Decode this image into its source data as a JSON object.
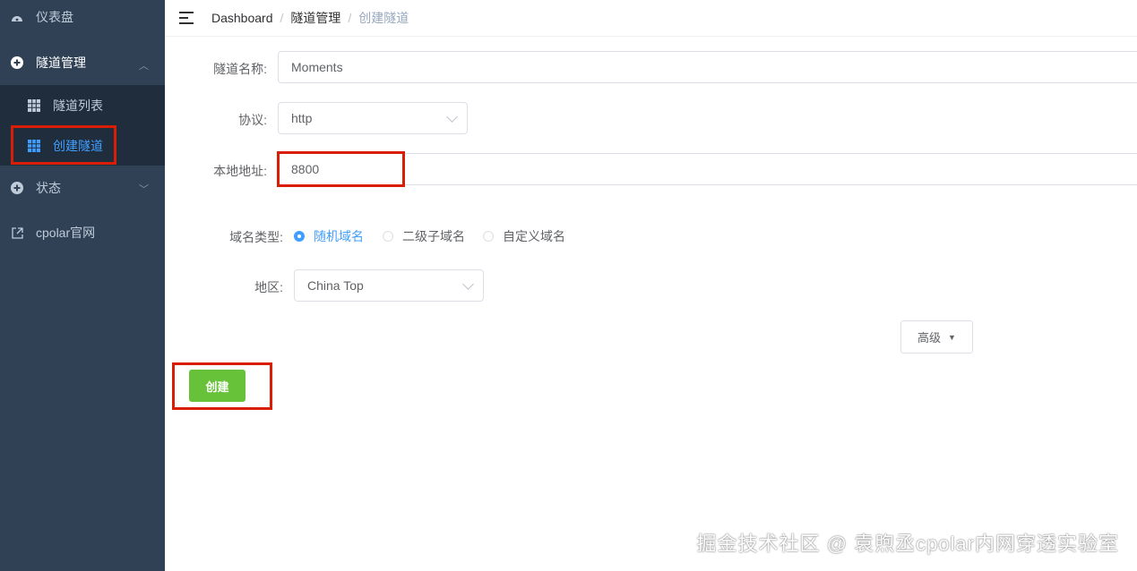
{
  "sidebar": {
    "items": [
      {
        "label": "仪表盘"
      },
      {
        "label": "隧道管理"
      },
      {
        "label": "状态"
      },
      {
        "label": "cpolar官网"
      }
    ],
    "sub_items": [
      {
        "label": "隧道列表"
      },
      {
        "label": "创建隧道"
      }
    ]
  },
  "breadcrumb": {
    "home": "Dashboard",
    "section": "隧道管理",
    "current": "创建隧道",
    "sep": "/"
  },
  "form": {
    "name_label": "隧道名称:",
    "name_value": "Moments",
    "protocol_label": "协议:",
    "protocol_value": "http",
    "local_label": "本地地址:",
    "local_value": "8800",
    "domain_type_label": "域名类型:",
    "domain_options": [
      "随机域名",
      "二级子域名",
      "自定义域名"
    ],
    "region_label": "地区:",
    "region_value": "China Top",
    "advanced_label": "高级",
    "create_label": "创建"
  },
  "watermark": "掘金技术社区 @ 袁煦丞cpolar内网穿透实验室",
  "colors": {
    "sidebar_bg": "#304156",
    "accent": "#409eff",
    "success": "#67c23a",
    "highlight": "#d81e06"
  }
}
